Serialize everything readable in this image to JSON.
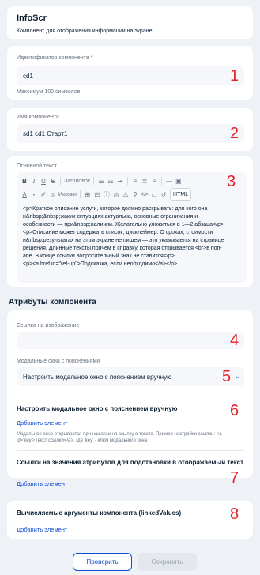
{
  "header": {
    "title": "InfoScr",
    "subtitle": "Компонент для отображения информации на экране"
  },
  "component_id": {
    "label": "Идентификатор компонента *",
    "value": "cd1",
    "hint": "Максимум 100 символов",
    "marker": "1"
  },
  "component_name": {
    "label": "Имя компонента",
    "value": "sd1 cd1 Старт1",
    "marker": "2"
  },
  "main_text": {
    "label": "Основной текст",
    "marker": "3",
    "toolbar": {
      "heading": "Заголовок",
      "icons": "Иконки",
      "html": "HTML"
    },
    "lines": [
      "<p>Краткое описание услуги, которое должно раскрывать: для кого она",
      "н&nbsp;&nbsp;жаких ситуациях актуальна, основные ограничения и",
      "особенности — при&nbsp;наличии. Желательно уложиться в 1—2 абзаца</p>",
      "<p>Описание может содержать список, дисклеймер. О сроках, стоимости",
      "н&nbsp;результатах на этом экране не пишем — это указывается на странице",
      "решения. Длинные тексты прячем в справку, которая открывается <br>в поп-",
      "апе. В конце ссылки вопросительный знак не ставится</p>",
      "<p><a href id=\"ref-up\">Подсказка, если необходимо</a></p>"
    ]
  },
  "attributes": {
    "title": "Атрибуты компонента",
    "image_link": {
      "label": "Ссылка на изображение",
      "value": "",
      "marker": "4"
    },
    "modals": {
      "label": "Модальные окна с пояснениями",
      "selected": "Настроить модальное окно с пояснением вручную",
      "marker": "5"
    },
    "manual_modal": {
      "title": "Настроить модальное окно с пояснением вручную",
      "add": "Добавить элемент",
      "hint": "Модальное окно открывается при нажатии на ссылку в тексте. Пример настройки ссылки: <a id='key'>Текст ссылки</a>, где 'key' - ключ модального окна",
      "marker": "6"
    },
    "attr_links": {
      "title": "Ссылки на значения атрибутов для подстановки в отображаемый текст",
      "add": "Добавить элемент",
      "marker": "7"
    },
    "computed": {
      "title": "Вычисляемые аргументы компонента (linkedValues)",
      "add": "Добавить элемент",
      "marker": "8"
    }
  },
  "footer": {
    "check": "Проверить",
    "save": "Сохранить"
  },
  "colors": {
    "accent": "#0d4cd3",
    "marker": "#e3242b",
    "background": "#eef1f5",
    "disabled": "#e4e8ee"
  }
}
